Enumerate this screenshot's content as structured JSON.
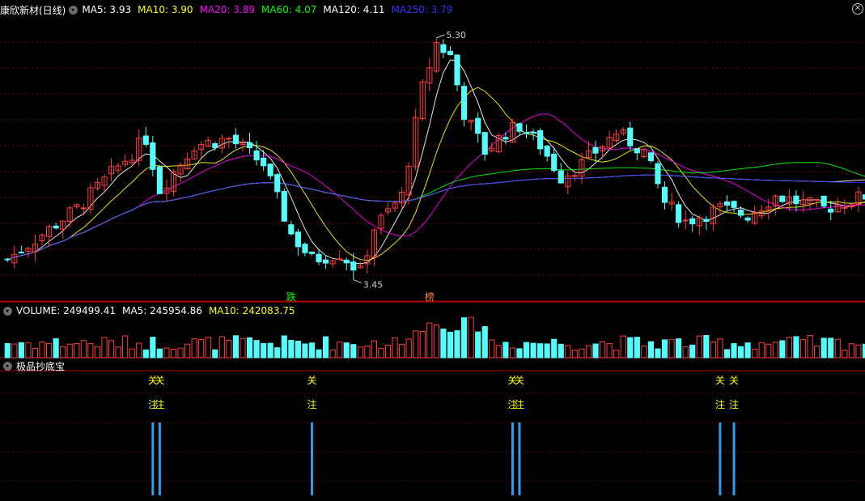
{
  "stock": {
    "name": "康欣新材(日线)"
  },
  "colors": {
    "up": "#ff3c3c",
    "down": "#54fcfc",
    "ma5": "#ffffff",
    "ma10": "#ffff00",
    "ma20": "#ff00ff",
    "ma60": "#00ff00",
    "ma120": "#ffffff",
    "ma250": "#3232ff",
    "grid": "#7a0000",
    "axis": "#b40000",
    "tag": "#ffff00",
    "bar": "#2d9ef0"
  },
  "main_legend": [
    {
      "text": "MA5: 3.93",
      "color": "#ffffff"
    },
    {
      "text": "MA10: 3.90",
      "color": "#ffff00"
    },
    {
      "text": "MA20: 3.89",
      "color": "#ff00ff"
    },
    {
      "text": "MA60: 4.07",
      "color": "#00ff00"
    },
    {
      "text": "MA120: 4.11",
      "color": "#ffffff"
    },
    {
      "text": "MA250: 3.79",
      "color": "#3232ff"
    }
  ],
  "volume_legend": [
    {
      "text": "VOLUME: 249499.41",
      "color": "#ffffff"
    },
    {
      "text": "MA5: 245954.86",
      "color": "#ffffff"
    },
    {
      "text": "MA10: 242083.75",
      "color": "#ffff00"
    }
  ],
  "indicator": {
    "title": "极品抄底宝"
  },
  "chart_data": {
    "type": "candlestick",
    "high_label": "5.30",
    "low_label": "3.45",
    "price_range": [
      3.3,
      5.45
    ],
    "markers": [
      {
        "text": "跌",
        "index": 41,
        "color": "#00ff00"
      },
      {
        "text": "榜",
        "index": 61,
        "color": "#ff8040"
      }
    ],
    "signals": [
      {
        "index": 21,
        "label": "关注"
      },
      {
        "index": 22,
        "label": "关注"
      },
      {
        "index": 44,
        "label": "关注"
      },
      {
        "index": 73,
        "label": "关注"
      },
      {
        "index": 74,
        "label": "关注"
      },
      {
        "index": 103,
        "label": "关注"
      },
      {
        "index": 105,
        "label": "关注"
      }
    ]
  }
}
